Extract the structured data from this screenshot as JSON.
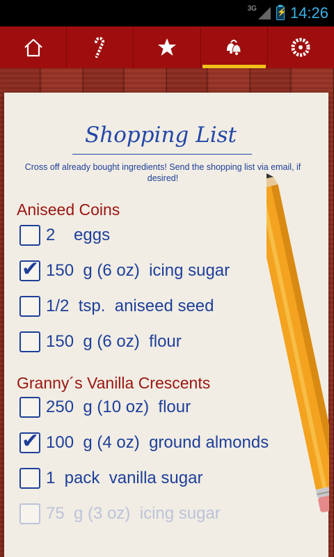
{
  "status_bar": {
    "network": "3G",
    "time": "14:26"
  },
  "tabs": [
    {
      "icon": "home-icon",
      "active": false
    },
    {
      "icon": "candy-cane-icon",
      "active": false
    },
    {
      "icon": "star-icon",
      "active": false
    },
    {
      "icon": "bells-icon",
      "active": true
    },
    {
      "icon": "wreath-icon",
      "active": false
    }
  ],
  "page": {
    "title": "Shopping List",
    "subtitle": "Cross off already bought ingredients! Send the shopping list via email, if desired!"
  },
  "sections": [
    {
      "name": "Aniseed Coins",
      "items": [
        {
          "text": "2    eggs",
          "checked": false
        },
        {
          "text": "150  g (6 oz)  icing sugar",
          "checked": true
        },
        {
          "text": "1/2  tsp.  aniseed seed",
          "checked": false
        },
        {
          "text": "150  g (6 oz)  flour",
          "checked": false
        }
      ]
    },
    {
      "name": "Granny´s Vanilla Crescents",
      "items": [
        {
          "text": "250  g (10 oz)  flour",
          "checked": false
        },
        {
          "text": "100  g (4 oz)  ground almonds",
          "checked": true
        },
        {
          "text": "1  pack  vanilla sugar",
          "checked": false
        },
        {
          "text": "75  g (3 oz)  icing sugar",
          "checked": false
        }
      ]
    }
  ],
  "colors": {
    "tabbar": "#9e0e0e",
    "active_indicator": "#f2c21b",
    "ink": "#1e3f9a",
    "section": "#9a1410"
  }
}
